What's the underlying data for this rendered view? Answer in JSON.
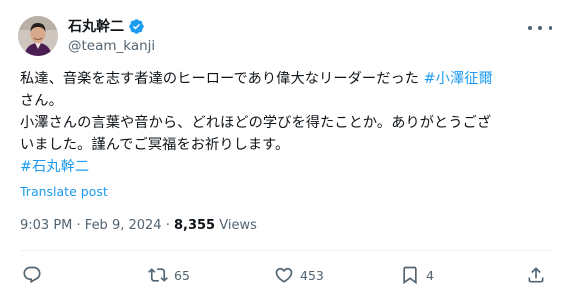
{
  "author": {
    "display_name": "石丸幹二",
    "handle": "@team_kanji",
    "verified_icon": "verified-badge-icon"
  },
  "post": {
    "lines": [
      [
        {
          "text": "私達、音楽を志す者達のヒーローであり偉大なリーダーだった ",
          "type": "text"
        },
        {
          "text": "#小澤征爾",
          "type": "hashtag"
        }
      ],
      [
        {
          "text": "さん。",
          "type": "text"
        }
      ],
      [
        {
          "text": "小澤さんの言葉や音から、どれほどの学びを得たことか。ありがとうござ",
          "type": "text"
        }
      ],
      [
        {
          "text": "いました。謹んでご冥福をお祈りします。",
          "type": "text"
        }
      ],
      [
        {
          "text": "#石丸幹二",
          "type": "hashtag"
        }
      ]
    ],
    "translate_label": "Translate post"
  },
  "meta": {
    "time": "9:03 PM",
    "separator": " · ",
    "date": "Feb 9, 2024",
    "views_count": "8,355",
    "views_label": " Views"
  },
  "actions": {
    "reply": {
      "icon": "reply-icon",
      "count": ""
    },
    "retweet": {
      "icon": "retweet-icon",
      "count": "65"
    },
    "like": {
      "icon": "heart-icon",
      "count": "453"
    },
    "bookmark": {
      "icon": "bookmark-icon",
      "count": "4"
    },
    "share": {
      "icon": "share-icon",
      "count": ""
    }
  },
  "colors": {
    "link": "#1d9bf0",
    "text": "#0f1419",
    "muted": "#536471",
    "divider": "#eff3f4"
  }
}
